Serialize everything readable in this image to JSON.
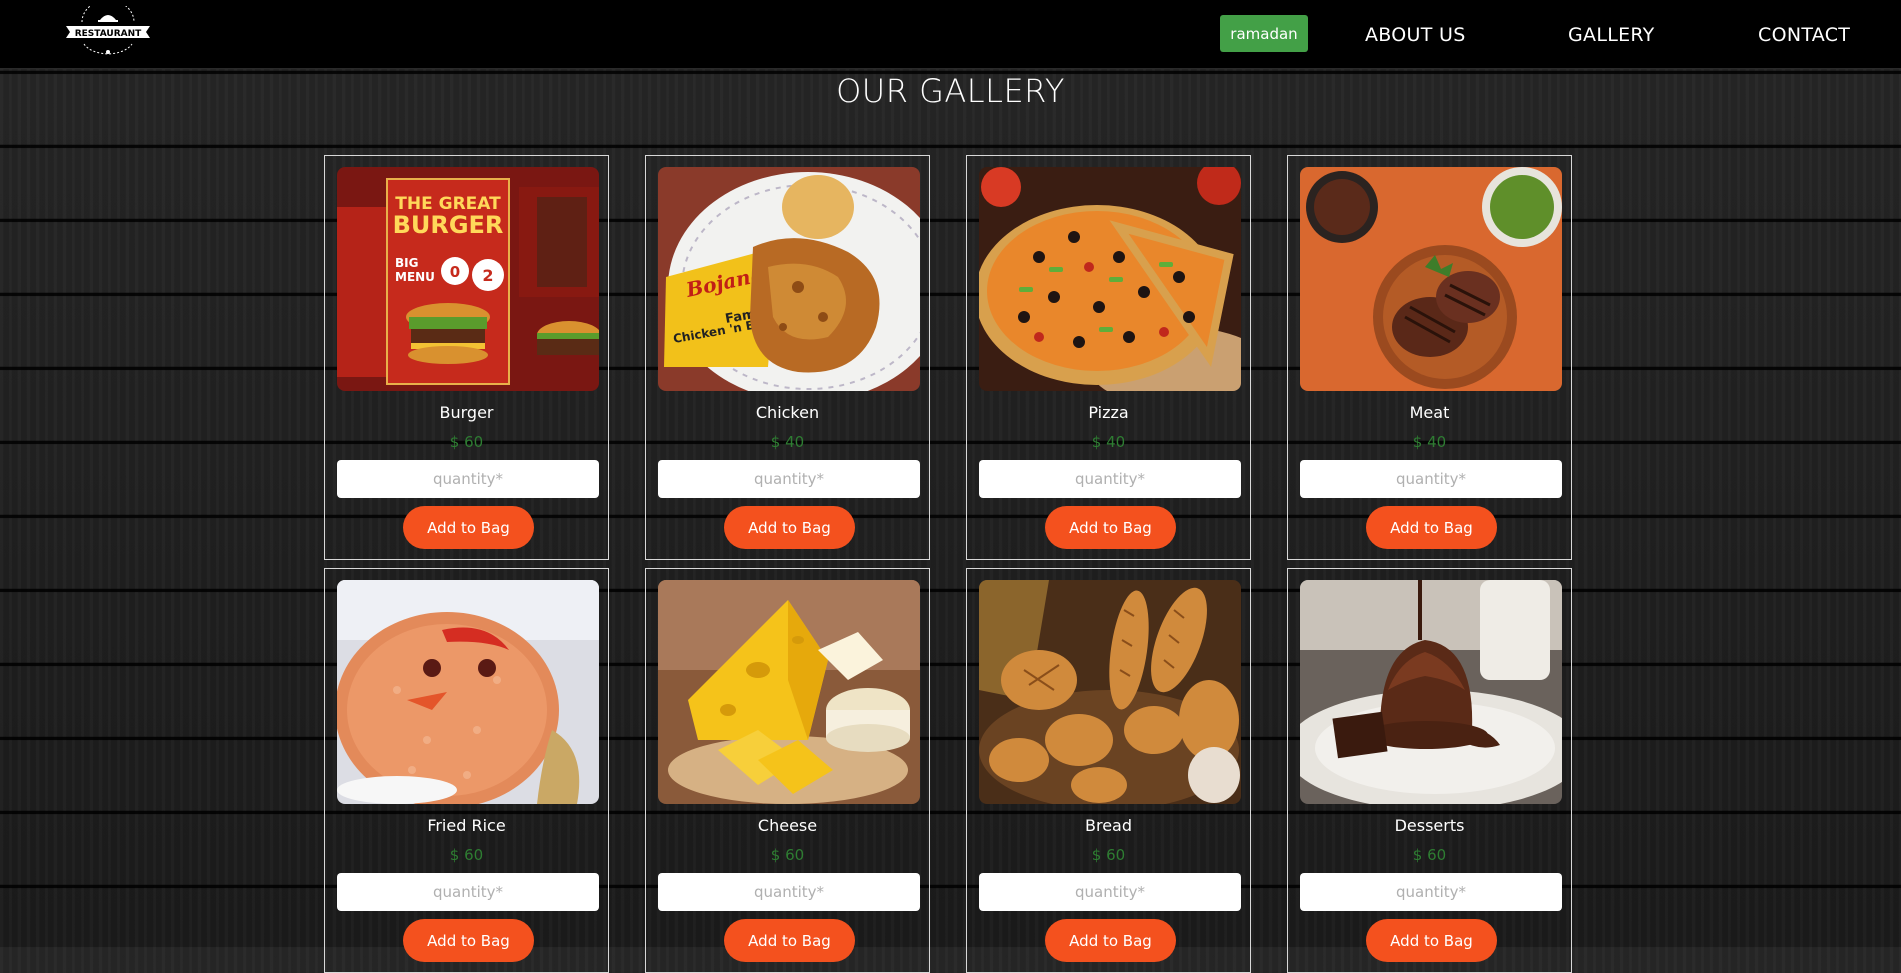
{
  "nav": {
    "logo_text": "RESTAURANT",
    "ramadan_label": "ramadan",
    "links": [
      "ABOUT US",
      "GALLERY",
      "CONTACT"
    ]
  },
  "page": {
    "title": "OUR GALLERY"
  },
  "items": [
    {
      "name": "Burger",
      "price": "$ 60",
      "qty_placeholder": "quantity*",
      "button": "Add to Bag",
      "image_text": [
        "THE GREAT",
        "BURGER",
        "BIG",
        "MENU",
        "0",
        "2"
      ]
    },
    {
      "name": "Chicken",
      "price": "$ 40",
      "qty_placeholder": "quantity*",
      "button": "Add to Bag",
      "image_text": [
        "Bojangles'",
        "Famous",
        "Chicken 'n Biscuits"
      ]
    },
    {
      "name": "Pizza",
      "price": "$ 40",
      "qty_placeholder": "quantity*",
      "button": "Add to Bag"
    },
    {
      "name": "Meat",
      "price": "$ 40",
      "qty_placeholder": "quantity*",
      "button": "Add to Bag"
    },
    {
      "name": "Fried Rice",
      "price": "$ 60",
      "qty_placeholder": "quantity*",
      "button": "Add to Bag"
    },
    {
      "name": "Cheese",
      "price": "$ 60",
      "qty_placeholder": "quantity*",
      "button": "Add to Bag"
    },
    {
      "name": "Bread",
      "price": "$ 60",
      "qty_placeholder": "quantity*",
      "button": "Add to Bag"
    },
    {
      "name": "Desserts",
      "price": "$ 60",
      "qty_placeholder": "quantity*",
      "button": "Add to Bag"
    }
  ],
  "colors": {
    "nav_bg": "#000000",
    "ramadan_button": "#43a047",
    "add_button": "#f4511e",
    "price_text": "#2e7d32"
  }
}
